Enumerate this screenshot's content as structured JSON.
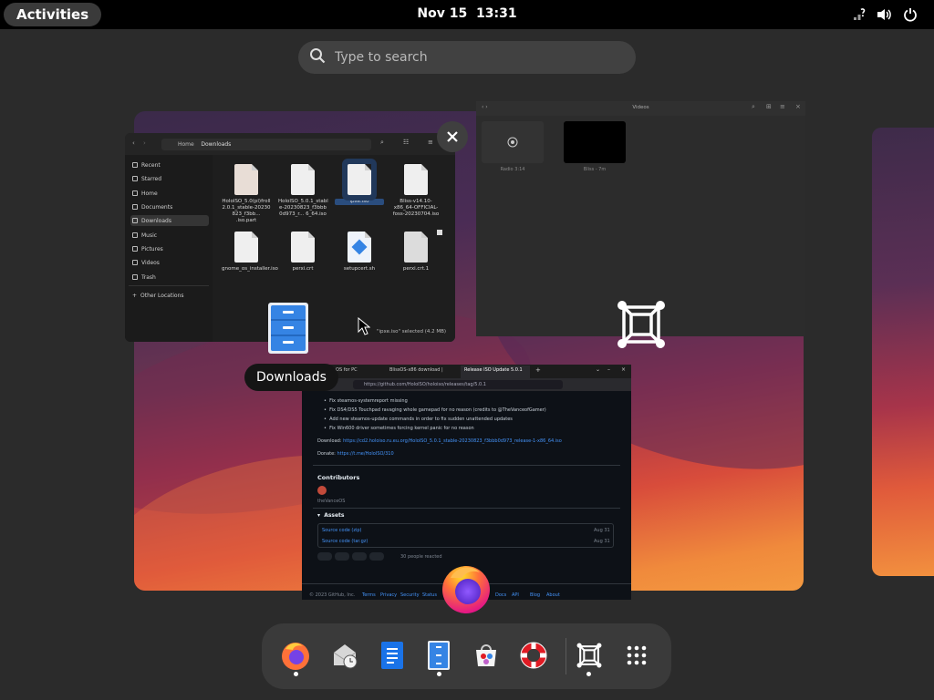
{
  "topbar": {
    "activities_label": "Activities",
    "date": "Nov 15",
    "time": "13:31",
    "icons": [
      "network-question-icon",
      "volume-icon",
      "power-icon"
    ]
  },
  "search": {
    "placeholder": "Type to search"
  },
  "tooltip": {
    "label": "Downloads"
  },
  "files_window": {
    "location_parent": "Home",
    "location_current": "Downloads",
    "sidebar": [
      "Recent",
      "Starred",
      "Home",
      "Documents",
      "Downloads",
      "Music",
      "Pictures",
      "Videos",
      "Trash",
      "Other Locations"
    ],
    "selected_sidebar": "Downloads",
    "files": [
      {
        "name": "HoloISO_5.0(pl)froll 2.0.1_stable-20230 823_f3bb... .iso.part"
      },
      {
        "name": "HoloISO_5.0.1_stabl e-20230823_f3bbb 0d973_r... 6_64.iso"
      },
      {
        "name": "ipxe.iso",
        "selected": true
      },
      {
        "name": "Bliss-v14.10-x86_64-OFFICIAL-foss-20230704.iso"
      },
      {
        "name": "gnome_os_installer.iso"
      },
      {
        "name": "perxi.crt"
      },
      {
        "name": "setupcert.sh"
      },
      {
        "name": "perxi.crt.1"
      }
    ],
    "status": "\"ipxe.iso\" selected (4.2 MB)"
  },
  "video_window": {
    "title": "Videos",
    "items": [
      "Radio 3:14",
      "Bliss - 7m"
    ]
  },
  "browser_window": {
    "tabs": [
      "Bliss OS for PC",
      "BlissOS-x86 download |",
      "Release ISO Update 5.0.1"
    ],
    "url": "https://github.com/HoloISO/holoiso/releases/tag/5.0.1",
    "bullets": [
      "Fix resolv.conf missing",
      "Fix steamos-systemreport missing",
      "Fix DS4/DS5 Touchpad ravaging whole gamepad for no reason (credits to @TheVanceofGamer)",
      "Add new steamos-update commands in order to fix sudden unattended updates",
      "Fix Win600 driver sometimes forcing kernel panic for no reason"
    ],
    "download_label": "Download:",
    "download_link": "https://cd2.holoiso.ru.eu.org/HoloISO_5.0.1_stable-20230823_f3bbb0d973_release-1-x86_64.iso",
    "donate_label": "Donate:",
    "donate_link": "https://t.me/HoloISO/310",
    "contributors_heading": "Contributors",
    "contributor_name": "theVanceOS",
    "assets_heading": "Assets",
    "assets": [
      {
        "name": "Source code (zip)",
        "date": "Aug 31"
      },
      {
        "name": "Source code (tar.gz)",
        "date": "Aug 31"
      }
    ],
    "reactions_text": "30 people reacted",
    "footer_items": [
      "© 2023 GitHub, Inc.",
      "Terms",
      "Privacy",
      "Security",
      "Status",
      "Docs",
      "Contact",
      "API",
      "Training",
      "Blog",
      "About"
    ]
  },
  "dash": {
    "apps": [
      {
        "name": "Firefox",
        "icon": "firefox-icon",
        "running": true
      },
      {
        "name": "Calendar Mail",
        "icon": "mail-calendar-icon",
        "running": false
      },
      {
        "name": "Writer",
        "icon": "writer-icon",
        "running": false
      },
      {
        "name": "Files",
        "icon": "files-icon",
        "running": true
      },
      {
        "name": "Software",
        "icon": "software-icon",
        "running": false
      },
      {
        "name": "Help",
        "icon": "help-icon",
        "running": false
      },
      {
        "name": "Video Player",
        "icon": "video-player-icon",
        "running": true
      },
      {
        "name": "Show Apps",
        "icon": "app-grid-icon",
        "running": false
      }
    ]
  },
  "colors": {
    "accent": "#3584e4",
    "topbar_bg": "#000000",
    "dash_bg": "#3a3a3a"
  }
}
